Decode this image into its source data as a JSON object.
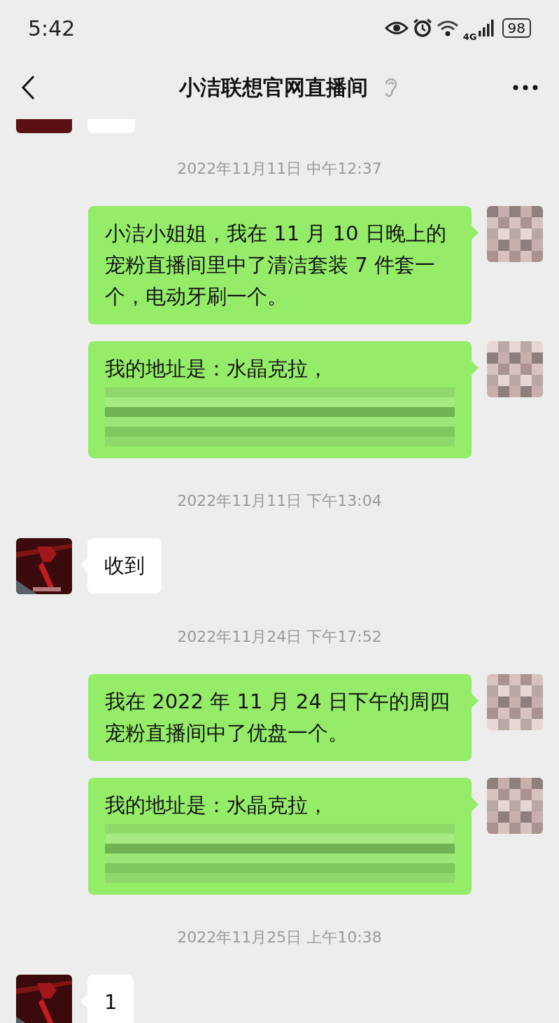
{
  "status_bar": {
    "time": "5:42",
    "network": "4G",
    "battery": "98"
  },
  "header": {
    "title": "小洁联想官网直播间",
    "earpiece_mode": true
  },
  "messages": [
    {
      "kind": "partial_received"
    },
    {
      "kind": "time",
      "text": "2022年11月11日 中午12:37"
    },
    {
      "kind": "sent",
      "text": "小洁小姐姐，我在 11 月 10 日晚上的宠粉直播间里中了清洁套装 7 件套一个，电动牙刷一个。",
      "redacted": false
    },
    {
      "kind": "sent",
      "text": "我的地址是：水晶克拉，",
      "redacted": true
    },
    {
      "kind": "time",
      "text": "2022年11月11日 下午13:04"
    },
    {
      "kind": "received",
      "text": "收到",
      "redacted": false
    },
    {
      "kind": "time",
      "text": "2022年11月24日 下午17:52"
    },
    {
      "kind": "sent",
      "text": "我在 2022 年 11 月 24 日下午的周四宠粉直播间中了优盘一个。",
      "redacted": false
    },
    {
      "kind": "sent",
      "text": "我的地址是：水晶克拉，",
      "redacted": true
    },
    {
      "kind": "time",
      "text": "2022年11月25日 上午10:38"
    },
    {
      "kind": "received",
      "text": "1",
      "redacted": false
    }
  ]
}
